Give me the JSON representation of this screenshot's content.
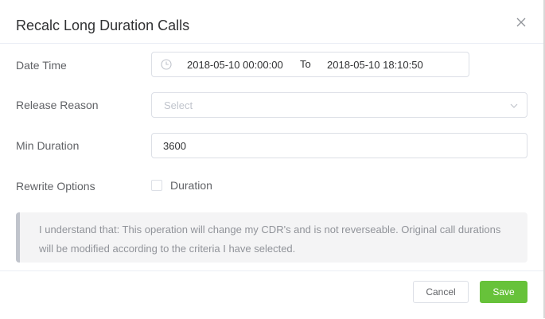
{
  "dialog": {
    "title": "Recalc Long Duration Calls"
  },
  "form": {
    "date_time": {
      "label": "Date Time",
      "start": "2018-05-10 00:00:00",
      "separator": "To",
      "end": "2018-05-10 18:10:50",
      "icon": "clock-icon"
    },
    "release_reason": {
      "label": "Release Reason",
      "placeholder": "Select",
      "icon": "chevron-down-icon"
    },
    "min_duration": {
      "label": "Min Duration",
      "value": "3600"
    },
    "rewrite_options": {
      "label": "Rewrite Options",
      "checkbox_label": "Duration",
      "checked": false
    }
  },
  "notice": {
    "text": "I understand that: This operation will change my CDR's and is not reverseable. Original call durations will be modified according to the criteria I have selected."
  },
  "footer": {
    "cancel_label": "Cancel",
    "save_label": "Save"
  },
  "colors": {
    "primary": "#67c23a",
    "text": "#606266",
    "muted": "#909399",
    "border": "#dcdfe6"
  }
}
